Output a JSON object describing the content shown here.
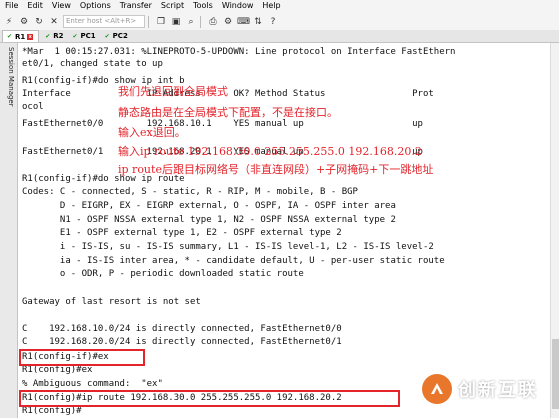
{
  "menu": [
    "File",
    "Edit",
    "View",
    "Options",
    "Transfer",
    "Script",
    "Tools",
    "Window",
    "Help"
  ],
  "toolbar": {
    "host_placeholder": "Enter host <Alt+R>"
  },
  "tabs": [
    {
      "label": "R1",
      "status": "active"
    },
    {
      "label": "R2",
      "status": "ok"
    },
    {
      "label": "PC1",
      "status": "ok"
    },
    {
      "label": "PC2",
      "status": "ok"
    }
  ],
  "sidebar": {
    "label": "Session Manager"
  },
  "terminal": {
    "lines": [
      "*Mar  1 00:15:27.031: %LINEPROTO-5-UPDOWN: Line protocol on Interface FastEthern",
      "et0/1, changed state to up",
      "R1(config-if)#do show ip int b",
      "Interface              IP-Address      OK? Method Status                Prot",
      "ocol",
      "FastEthernet0/0        192.168.10.1    YES manual up                    up",
      "",
      "FastEthernet0/1        192.168.20.1    YES manual up                    up",
      "",
      "R1(config-if)#do show ip route",
      "Codes: C - connected, S - static, R - RIP, M - mobile, B - BGP",
      "       D - EIGRP, EX - EIGRP external, O - OSPF, IA - OSPF inter area",
      "       N1 - OSPF NSSA external type 1, N2 - OSPF NSSA external type 2",
      "       E1 - OSPF external type 1, E2 - OSPF external type 2",
      "       i - IS-IS, su - IS-IS summary, L1 - IS-IS level-1, L2 - IS-IS level-2",
      "       ia - IS-IS inter area, * - candidate default, U - per-user static route",
      "       o - ODR, P - periodic downloaded static route",
      "",
      "Gateway of last resort is not set",
      "",
      "C    192.168.10.0/24 is directly connected, FastEthernet0/0",
      "C    192.168.20.0/24 is directly connected, FastEthernet0/1",
      "R1(config-if)#ex",
      "R1(config)#ex",
      "% Ambiguous command:  \"ex\"",
      "R1(config)#ip route 192.168.30.0 255.255.255.0 192.168.20.2",
      "R1(config)#"
    ]
  },
  "annotations": [
    "我们先退回到全局模式",
    "静态路由是在全局模式下配置，不是在接口。",
    "输入ex退回。",
    "输入ip route 192.168.30.0 255.255.255.0 192.168.20.2",
    "ip route后跟目标网络号（非直连网段）+子网掩码+下一跳地址"
  ],
  "watermark": {
    "text": "创新互联"
  },
  "colors": {
    "annotation": "#e3242b",
    "highlight": "#e3242b",
    "terminal_bg": "#ffffff",
    "logo": "#e8772c"
  }
}
